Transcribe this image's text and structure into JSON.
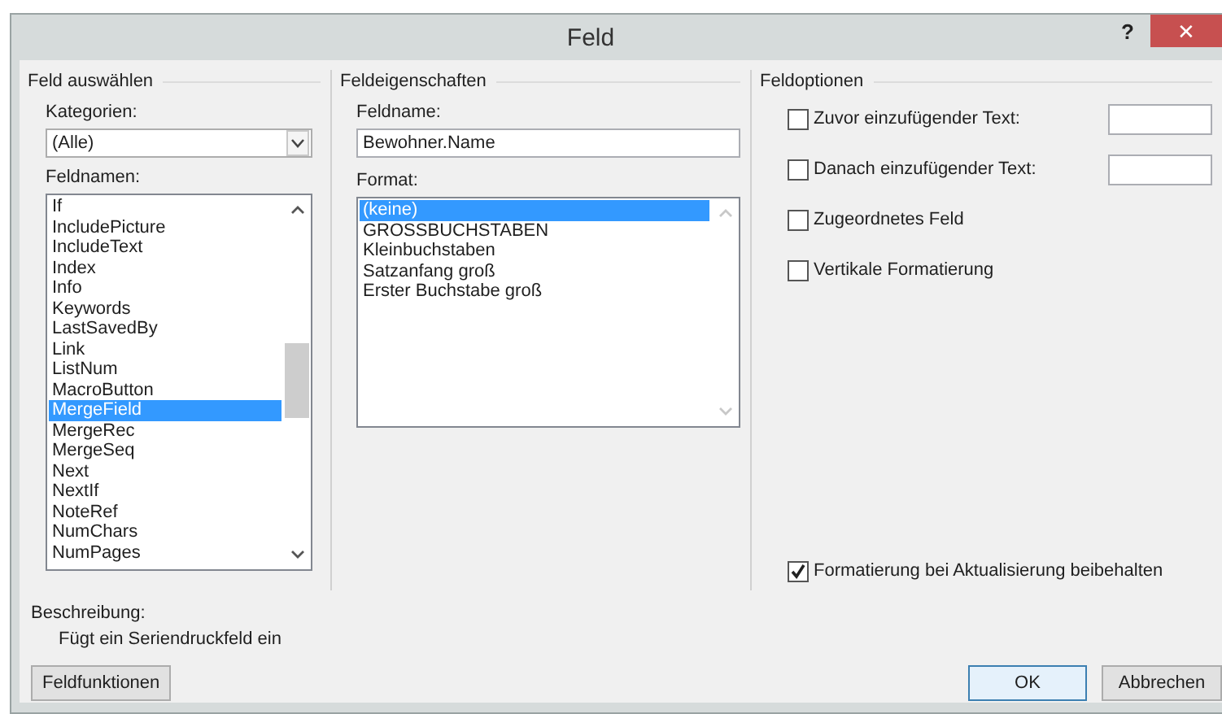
{
  "window": {
    "title": "Feld",
    "help": "?",
    "close": "✕"
  },
  "select_panel": {
    "title": "Feld auswählen",
    "categories_label": "Kategorien:",
    "categories_value": "(Alle)",
    "names_label": "Feldnamen:",
    "names": [
      {
        "label": "If",
        "selected": false
      },
      {
        "label": "IncludePicture",
        "selected": false
      },
      {
        "label": "IncludeText",
        "selected": false
      },
      {
        "label": "Index",
        "selected": false
      },
      {
        "label": "Info",
        "selected": false
      },
      {
        "label": "Keywords",
        "selected": false
      },
      {
        "label": "LastSavedBy",
        "selected": false
      },
      {
        "label": "Link",
        "selected": false
      },
      {
        "label": "ListNum",
        "selected": false
      },
      {
        "label": "MacroButton",
        "selected": false
      },
      {
        "label": "MergeField",
        "selected": true
      },
      {
        "label": "MergeRec",
        "selected": false
      },
      {
        "label": "MergeSeq",
        "selected": false
      },
      {
        "label": "Next",
        "selected": false
      },
      {
        "label": "NextIf",
        "selected": false
      },
      {
        "label": "NoteRef",
        "selected": false
      },
      {
        "label": "NumChars",
        "selected": false
      },
      {
        "label": "NumPages",
        "selected": false
      }
    ]
  },
  "properties_panel": {
    "title": "Feldeigenschaften",
    "name_label": "Feldname:",
    "name_value": "Bewohner.Name",
    "format_label": "Format:",
    "formats": [
      {
        "label": "(keine)",
        "selected": true
      },
      {
        "label": "GROSSBUCHSTABEN",
        "selected": false
      },
      {
        "label": "Kleinbuchstaben",
        "selected": false
      },
      {
        "label": "Satzanfang groß",
        "selected": false
      },
      {
        "label": "Erster Buchstabe groß",
        "selected": false
      }
    ]
  },
  "options_panel": {
    "title": "Feldoptionen",
    "options": [
      {
        "label": "Zuvor einzufügender Text:",
        "checked": false,
        "kind": "text"
      },
      {
        "label": "Danach einzufügender Text:",
        "checked": false,
        "kind": "text"
      },
      {
        "label": "Zugeordnetes Feld",
        "checked": false,
        "kind": "plain"
      },
      {
        "label": "Vertikale Formatierung",
        "checked": false,
        "kind": "plain"
      }
    ],
    "keep_formatting": {
      "label": "Formatierung bei Aktualisierung beibehalten",
      "checked": true
    }
  },
  "description": {
    "label": "Beschreibung:",
    "text": "Fügt ein Seriendruckfeld ein"
  },
  "buttons": {
    "field_codes": "Feldfunktionen",
    "ok": "OK",
    "cancel": "Abbrechen"
  }
}
